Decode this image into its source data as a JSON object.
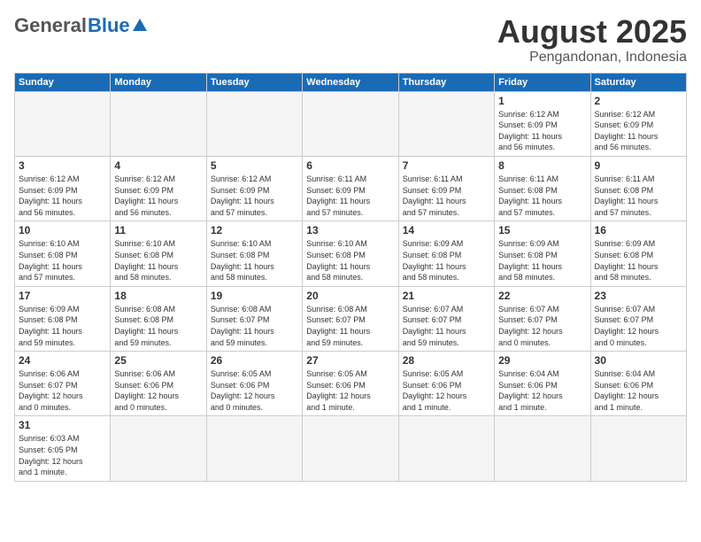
{
  "header": {
    "logo_general": "General",
    "logo_blue": "Blue",
    "title": "August 2025",
    "subtitle": "Pengandonan, Indonesia"
  },
  "weekdays": [
    "Sunday",
    "Monday",
    "Tuesday",
    "Wednesday",
    "Thursday",
    "Friday",
    "Saturday"
  ],
  "weeks": [
    [
      {
        "day": "",
        "info": ""
      },
      {
        "day": "",
        "info": ""
      },
      {
        "day": "",
        "info": ""
      },
      {
        "day": "",
        "info": ""
      },
      {
        "day": "",
        "info": ""
      },
      {
        "day": "1",
        "info": "Sunrise: 6:12 AM\nSunset: 6:09 PM\nDaylight: 11 hours\nand 56 minutes."
      },
      {
        "day": "2",
        "info": "Sunrise: 6:12 AM\nSunset: 6:09 PM\nDaylight: 11 hours\nand 56 minutes."
      }
    ],
    [
      {
        "day": "3",
        "info": "Sunrise: 6:12 AM\nSunset: 6:09 PM\nDaylight: 11 hours\nand 56 minutes."
      },
      {
        "day": "4",
        "info": "Sunrise: 6:12 AM\nSunset: 6:09 PM\nDaylight: 11 hours\nand 56 minutes."
      },
      {
        "day": "5",
        "info": "Sunrise: 6:12 AM\nSunset: 6:09 PM\nDaylight: 11 hours\nand 57 minutes."
      },
      {
        "day": "6",
        "info": "Sunrise: 6:11 AM\nSunset: 6:09 PM\nDaylight: 11 hours\nand 57 minutes."
      },
      {
        "day": "7",
        "info": "Sunrise: 6:11 AM\nSunset: 6:09 PM\nDaylight: 11 hours\nand 57 minutes."
      },
      {
        "day": "8",
        "info": "Sunrise: 6:11 AM\nSunset: 6:08 PM\nDaylight: 11 hours\nand 57 minutes."
      },
      {
        "day": "9",
        "info": "Sunrise: 6:11 AM\nSunset: 6:08 PM\nDaylight: 11 hours\nand 57 minutes."
      }
    ],
    [
      {
        "day": "10",
        "info": "Sunrise: 6:10 AM\nSunset: 6:08 PM\nDaylight: 11 hours\nand 57 minutes."
      },
      {
        "day": "11",
        "info": "Sunrise: 6:10 AM\nSunset: 6:08 PM\nDaylight: 11 hours\nand 58 minutes."
      },
      {
        "day": "12",
        "info": "Sunrise: 6:10 AM\nSunset: 6:08 PM\nDaylight: 11 hours\nand 58 minutes."
      },
      {
        "day": "13",
        "info": "Sunrise: 6:10 AM\nSunset: 6:08 PM\nDaylight: 11 hours\nand 58 minutes."
      },
      {
        "day": "14",
        "info": "Sunrise: 6:09 AM\nSunset: 6:08 PM\nDaylight: 11 hours\nand 58 minutes."
      },
      {
        "day": "15",
        "info": "Sunrise: 6:09 AM\nSunset: 6:08 PM\nDaylight: 11 hours\nand 58 minutes."
      },
      {
        "day": "16",
        "info": "Sunrise: 6:09 AM\nSunset: 6:08 PM\nDaylight: 11 hours\nand 58 minutes."
      }
    ],
    [
      {
        "day": "17",
        "info": "Sunrise: 6:09 AM\nSunset: 6:08 PM\nDaylight: 11 hours\nand 59 minutes."
      },
      {
        "day": "18",
        "info": "Sunrise: 6:08 AM\nSunset: 6:08 PM\nDaylight: 11 hours\nand 59 minutes."
      },
      {
        "day": "19",
        "info": "Sunrise: 6:08 AM\nSunset: 6:07 PM\nDaylight: 11 hours\nand 59 minutes."
      },
      {
        "day": "20",
        "info": "Sunrise: 6:08 AM\nSunset: 6:07 PM\nDaylight: 11 hours\nand 59 minutes."
      },
      {
        "day": "21",
        "info": "Sunrise: 6:07 AM\nSunset: 6:07 PM\nDaylight: 11 hours\nand 59 minutes."
      },
      {
        "day": "22",
        "info": "Sunrise: 6:07 AM\nSunset: 6:07 PM\nDaylight: 12 hours\nand 0 minutes."
      },
      {
        "day": "23",
        "info": "Sunrise: 6:07 AM\nSunset: 6:07 PM\nDaylight: 12 hours\nand 0 minutes."
      }
    ],
    [
      {
        "day": "24",
        "info": "Sunrise: 6:06 AM\nSunset: 6:07 PM\nDaylight: 12 hours\nand 0 minutes."
      },
      {
        "day": "25",
        "info": "Sunrise: 6:06 AM\nSunset: 6:06 PM\nDaylight: 12 hours\nand 0 minutes."
      },
      {
        "day": "26",
        "info": "Sunrise: 6:05 AM\nSunset: 6:06 PM\nDaylight: 12 hours\nand 0 minutes."
      },
      {
        "day": "27",
        "info": "Sunrise: 6:05 AM\nSunset: 6:06 PM\nDaylight: 12 hours\nand 1 minute."
      },
      {
        "day": "28",
        "info": "Sunrise: 6:05 AM\nSunset: 6:06 PM\nDaylight: 12 hours\nand 1 minute."
      },
      {
        "day": "29",
        "info": "Sunrise: 6:04 AM\nSunset: 6:06 PM\nDaylight: 12 hours\nand 1 minute."
      },
      {
        "day": "30",
        "info": "Sunrise: 6:04 AM\nSunset: 6:06 PM\nDaylight: 12 hours\nand 1 minute."
      }
    ],
    [
      {
        "day": "31",
        "info": "Sunrise: 6:03 AM\nSunset: 6:05 PM\nDaylight: 12 hours\nand 1 minute."
      },
      {
        "day": "",
        "info": ""
      },
      {
        "day": "",
        "info": ""
      },
      {
        "day": "",
        "info": ""
      },
      {
        "day": "",
        "info": ""
      },
      {
        "day": "",
        "info": ""
      },
      {
        "day": "",
        "info": ""
      }
    ]
  ]
}
